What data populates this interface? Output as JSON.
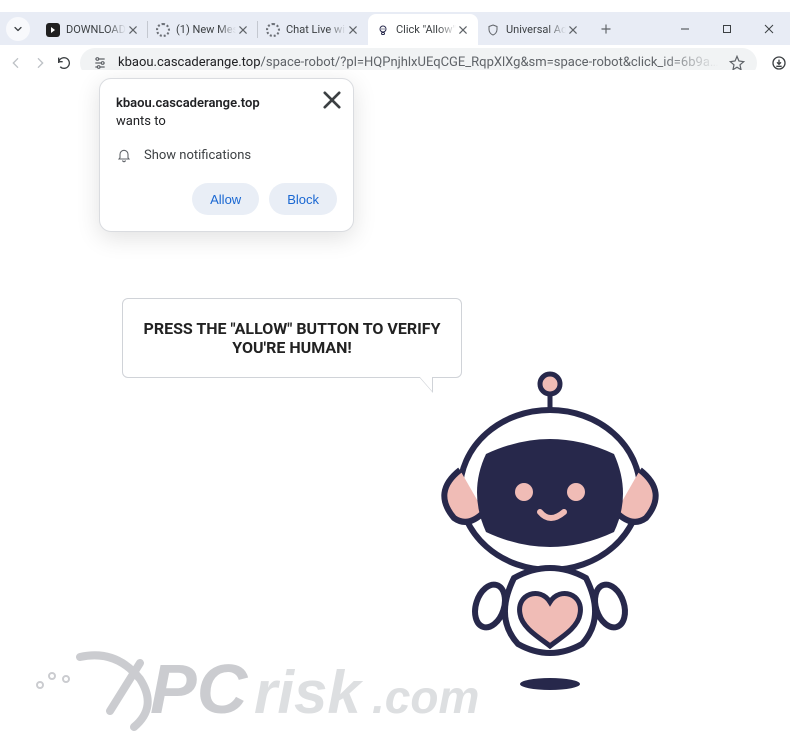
{
  "window": {
    "controls": {
      "minimize": "minimize",
      "maximize": "maximize",
      "close": "close"
    }
  },
  "tabs": [
    {
      "label": "DOWNLOAD:",
      "favicon": "youtube",
      "active": false
    },
    {
      "label": "(1) New Mess",
      "favicon": "spinner",
      "active": false
    },
    {
      "label": "Chat Live with",
      "favicon": "spinner",
      "active": false
    },
    {
      "label": "Click \"Allow\"",
      "favicon": "robot",
      "active": true
    },
    {
      "label": "Universal Ad",
      "favicon": "shield",
      "active": false
    }
  ],
  "toolbar": {
    "url_domain": "kbaou.cascaderange.top",
    "url_path": "/space-robot/?pl=HQPnjhlxUEqCGE_RqpXlXg&sm=space-robot&click_id=6b9a…"
  },
  "permission": {
    "origin_bold": "kbaou.cascaderange.top",
    "wants_to": " wants to",
    "option_label": "Show notifications",
    "allow_label": "Allow",
    "block_label": "Block"
  },
  "content": {
    "bubble_line1": "PRESS THE \"ALLOW\" BUTTON TO VERIFY",
    "bubble_line2": "YOU'RE HUMAN!"
  },
  "watermark": {
    "text_pc": "PC",
    "text_risk": "risk",
    "tld": ".com"
  },
  "colors": {
    "robot_navy": "#27284b",
    "robot_pink": "#f0bcb6",
    "chrome_blue": "#1967d2"
  }
}
